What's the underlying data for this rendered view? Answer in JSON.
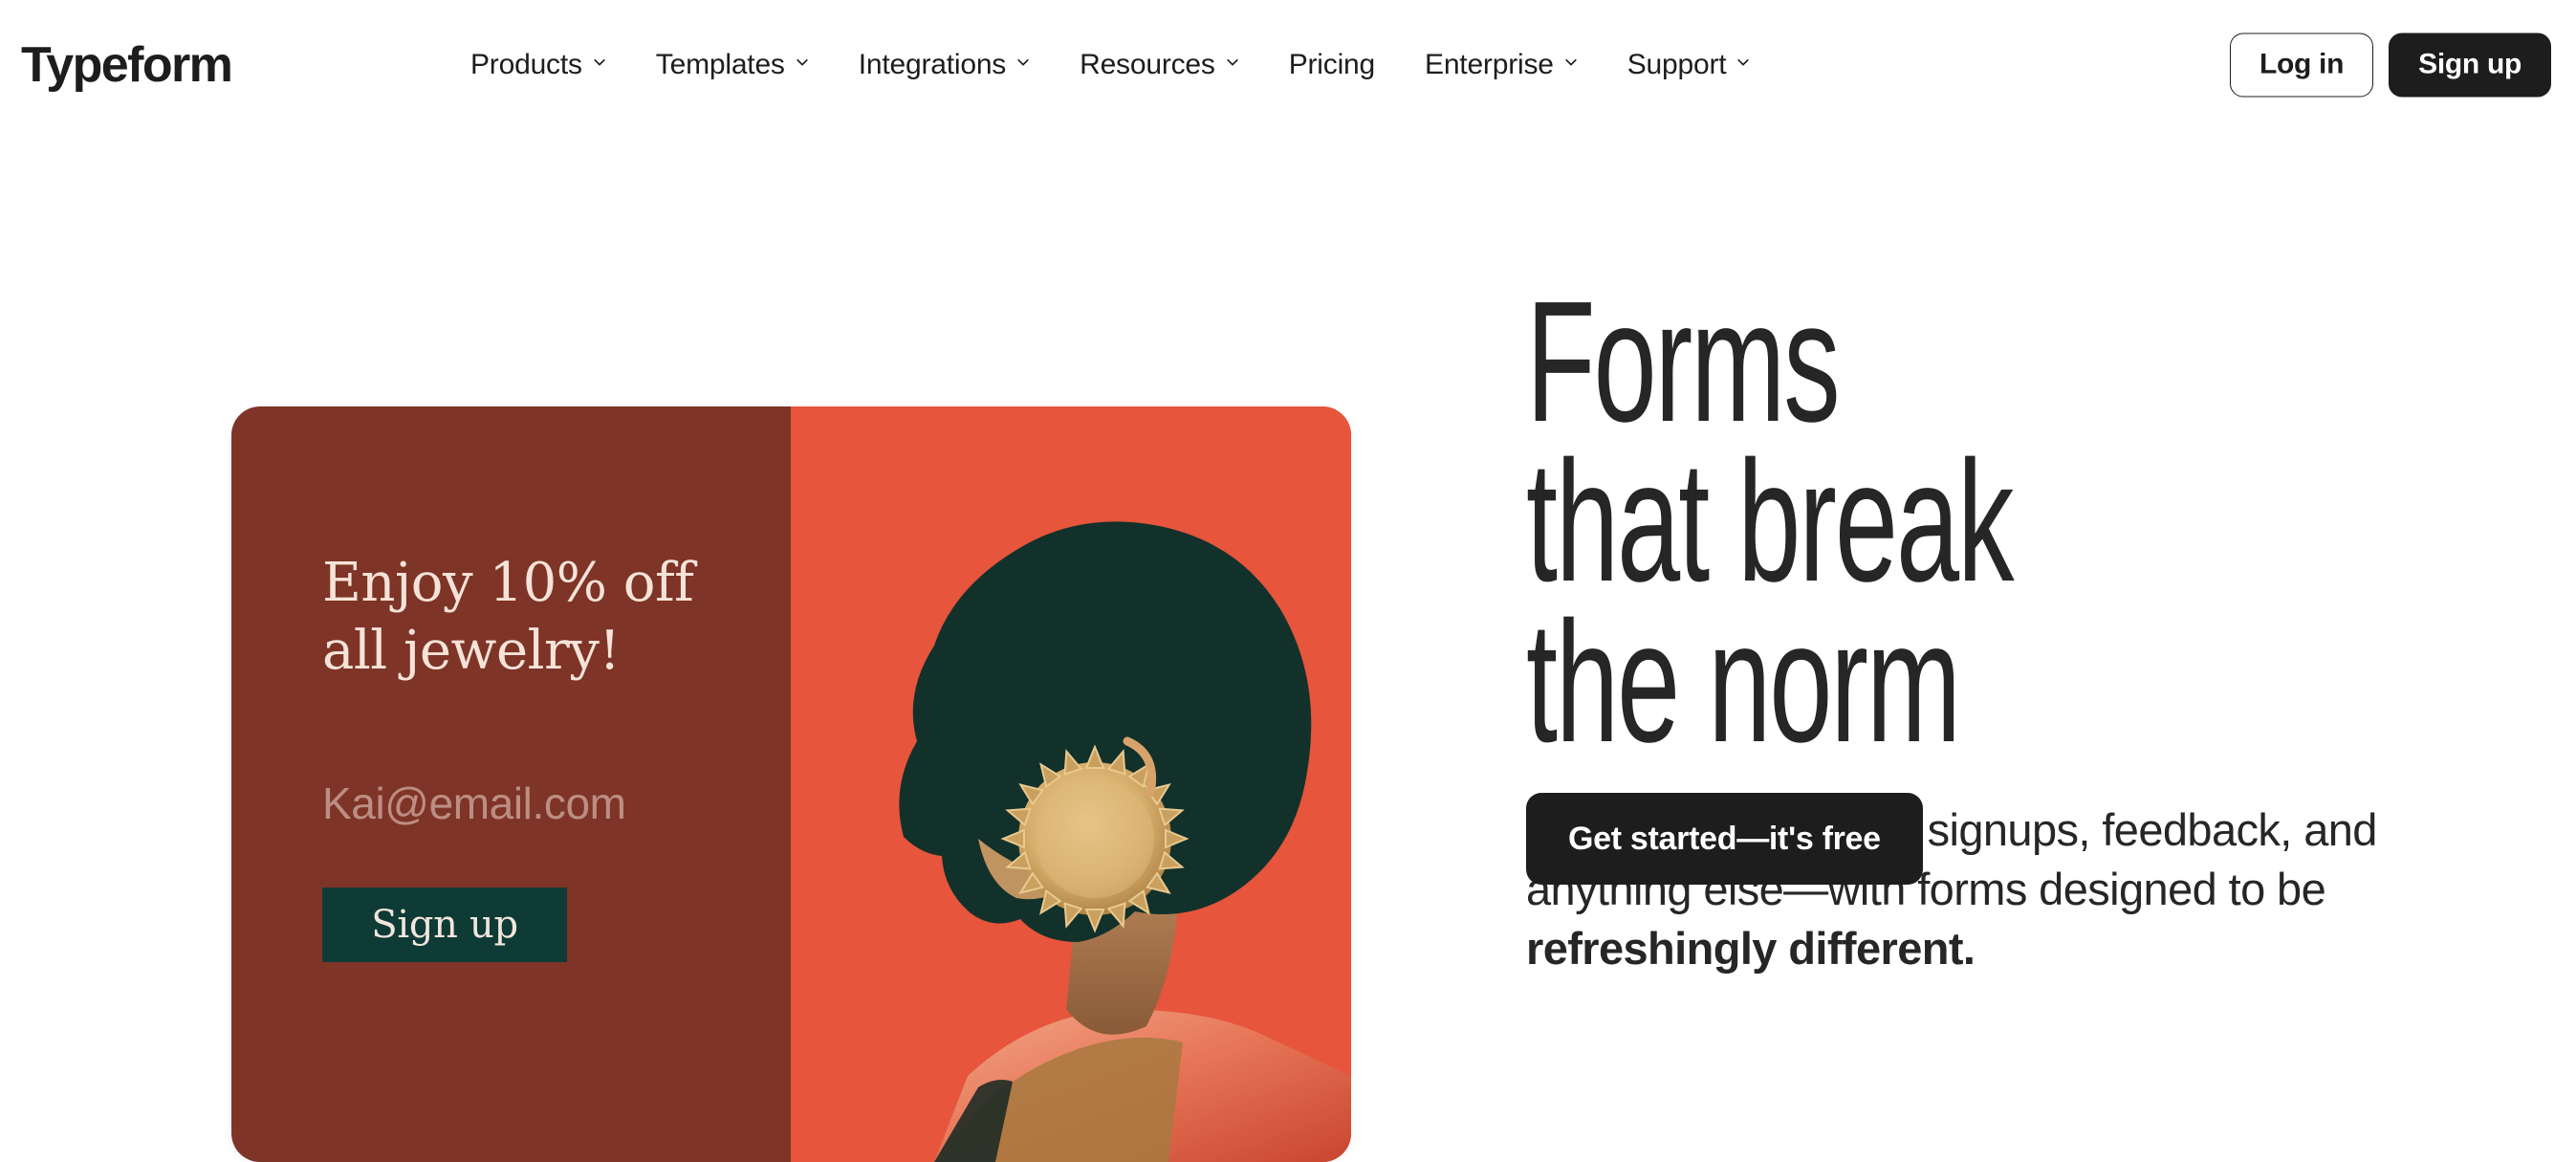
{
  "brand": {
    "name": "Typeform",
    "accent_dark": "#1d1d1d",
    "card_maroon": "#7e3427",
    "card_orange": "#e6553c",
    "card_green": "#0e3b35",
    "card_cream": "#f6e3d8"
  },
  "header": {
    "nav": [
      {
        "label": "Products",
        "has_dropdown": true,
        "icon": "chevron-down-icon"
      },
      {
        "label": "Templates",
        "has_dropdown": true,
        "icon": "chevron-down-icon"
      },
      {
        "label": "Integrations",
        "has_dropdown": true,
        "icon": "chevron-down-icon"
      },
      {
        "label": "Resources",
        "has_dropdown": true,
        "icon": "chevron-down-icon"
      },
      {
        "label": "Pricing",
        "has_dropdown": false,
        "icon": ""
      },
      {
        "label": "Enterprise",
        "has_dropdown": true,
        "icon": "chevron-down-icon"
      },
      {
        "label": "Support",
        "has_dropdown": true,
        "icon": "chevron-down-icon"
      }
    ],
    "login_label": "Log in",
    "signup_label": "Sign up"
  },
  "hero": {
    "headline": "Forms\nthat break\nthe norm",
    "subhead_plain": "Get more data—like signups, feedback, and anything else—with forms designed to be ",
    "subhead_bold": "refreshingly different.",
    "cta_label": "Get started—it's free",
    "card": {
      "question": "Enjoy 10% off all jewelry!",
      "email_placeholder": "Kai@email.com",
      "submit_label": "Sign up",
      "photo_alt": "side profile portrait with gold sunburst earring on orange background"
    }
  }
}
